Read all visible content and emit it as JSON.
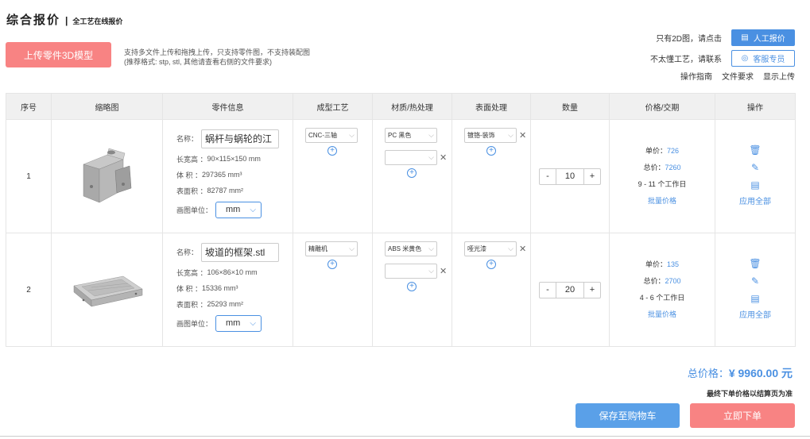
{
  "header": {
    "title": "综合报价",
    "separator": "|",
    "subtitle": "全工艺在线报价"
  },
  "upload": {
    "button_label": "上传零件3D模型",
    "desc_line1": "支持多文件上传和拖拽上传，只支持零件图，不支持装配图",
    "desc_line2": "(推荐格式: stp, stl, 其他请查看右侧的文件要求)"
  },
  "right": {
    "only2d_text": "只有2D图，请点击",
    "manual_quote_label": "人工报价",
    "no_process_text": "不太懂工艺，请联系",
    "service_label": "客服专员",
    "links": [
      "操作指南",
      "文件要求",
      "显示上传"
    ]
  },
  "table": {
    "headers": [
      "序号",
      "缩略图",
      "零件信息",
      "成型工艺",
      "材质/热处理",
      "表面处理",
      "数量",
      "价格/交期",
      "操作"
    ],
    "labels": {
      "name": "名称：",
      "dims": "长宽高 ：",
      "volume": "体 积 ：",
      "surface": "表面积 ：",
      "unit": "画图单位：",
      "unit_price": "单价：",
      "total_price": "总价：",
      "bulk": "批量价格",
      "apply_all": "应用全部"
    },
    "rows": [
      {
        "index": "1",
        "name": "蜗杆与蜗轮的江",
        "dims": "90×115×150 mm",
        "volume": "297365 mm³",
        "surface": "82787 mm²",
        "unit": "mm",
        "process": "CNC-三轴",
        "material": "PC 黑色",
        "surface_treat": "镀铬-装饰",
        "qty": "10",
        "unit_price": "726",
        "total": "7260",
        "lead": "9 - 11 个工作日"
      },
      {
        "index": "2",
        "name": "坡道的框架.stl",
        "dims": "106×86×10 mm",
        "volume": "15336 mm³",
        "surface": "25293 mm²",
        "unit": "mm",
        "process": "精雕机",
        "material": "ABS 米黄色",
        "surface_treat": "哑光漆",
        "qty": "20",
        "unit_price": "135",
        "total": "2700",
        "lead": "4 - 6 个工作日"
      }
    ]
  },
  "footer": {
    "total_label": "总价格：",
    "total_value": "¥ 9960.00 元",
    "note": "最终下单价格以结算页为准",
    "cart_label": "保存至购物车",
    "order_label": "立即下单"
  },
  "colors": {
    "accent": "#4a90e2",
    "pink": "#f88383"
  }
}
